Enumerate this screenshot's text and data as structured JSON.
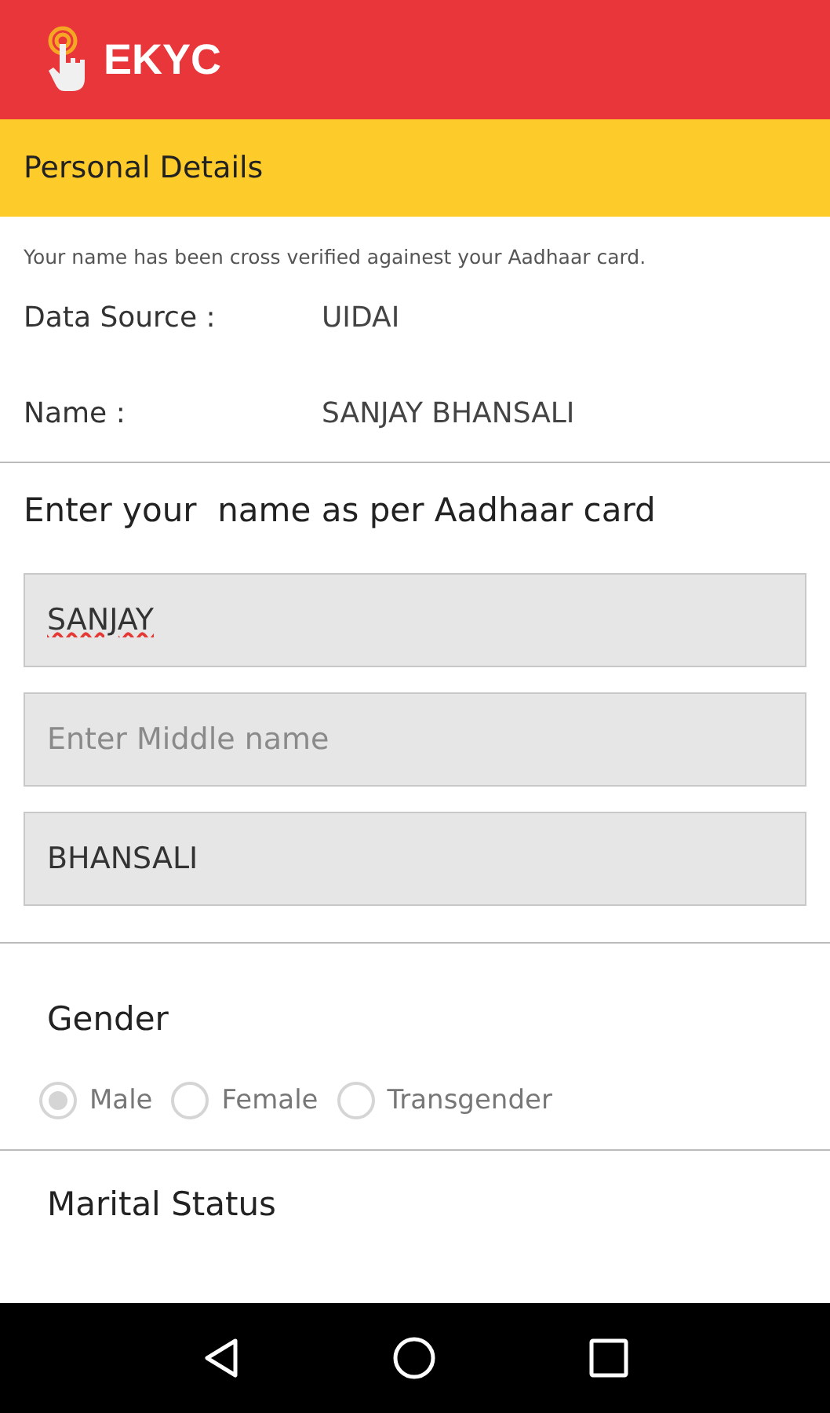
{
  "app_bar": {
    "title": "EKYC"
  },
  "section_header": "Personal Details",
  "info_text": "Your name has been cross verified againest your Aadhaar card.",
  "details": [
    {
      "label": "Data Source :",
      "value": "UIDAI"
    },
    {
      "label": "Name :",
      "value": "SANJAY BHANSALI"
    }
  ],
  "name_prompt": "Enter your  name as per Aadhaar card",
  "name_fields": [
    {
      "value": "SANJAY",
      "spell_error": true
    },
    {
      "placeholder": "Enter Middle name"
    },
    {
      "value": "BHANSALI",
      "spell_error": false
    }
  ],
  "gender": {
    "label": "Gender",
    "disabled": true,
    "options": [
      {
        "label": "Male",
        "selected": true
      },
      {
        "label": "Female",
        "selected": false
      },
      {
        "label": "Transgender",
        "selected": false
      }
    ]
  },
  "marital_status": {
    "label": "Marital Status"
  }
}
